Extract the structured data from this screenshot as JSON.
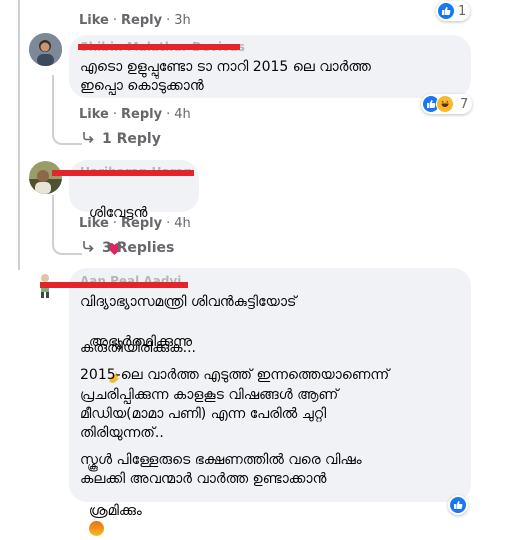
{
  "comments": [
    {
      "actions": {
        "like": "Like",
        "reply": "Reply",
        "time": "3h"
      },
      "reaction_count": "1"
    },
    {
      "author": "Shibin Malathur Devivas",
      "text_lines": [
        "എടൊ ഉളുപ്പുണ്ടോ ടാ നാറി 2015 ലെ വാർത്ത",
        "ഇപ്പൊ കൊടുക്കാൻ"
      ],
      "actions": {
        "like": "Like",
        "reply": "Reply",
        "time": "4h"
      },
      "reaction_count": "7",
      "replies_label": "1 Reply"
    },
    {
      "author": "Hariharan Haran",
      "text": "ശിവേട്ടൻ",
      "emoji": "heart",
      "actions": {
        "like": "Like",
        "reply": "Reply",
        "time": "4h"
      },
      "replies_label": "3 Replies"
    },
    {
      "author": "Aan Peal Aadvi",
      "paragraphs": [
        [
          "വിദ്യാഭ്യാസമന്ത്രി ശിവൻകുട്ടിയോട്",
          "അഭ്യർത്ഥിക്കുന്നു"
        ],
        [
          "കരുതിയിരിക്കുക..."
        ],
        [
          "2015-ലെ വാർത്ത എടുത്ത് ഇന്നത്തെയാണെന്ന്",
          "പ്രചരിപ്പിക്കുന്ന കാളകൂട വിഷങ്ങൾ ആണ്",
          "മീഡിയ(മാമാ പണി) എന്ന പേരിൽ ചുറ്റി",
          "തിരിയുന്നത്.."
        ],
        [
          "സ്കൂൾ പിള്ളേരുടെ ഭക്ഷണത്തിൽ വരെ വിഷം",
          "കലക്കി അവന്മാർ വാർത്ത ഉണ്ടാക്കാൻ",
          "ശ്രമിക്കും"
        ]
      ]
    }
  ],
  "colors": {
    "like_blue": "#1877f2",
    "bubble": "#f0f2f5",
    "meta": "#65676b",
    "redaction": "#e4242b"
  }
}
